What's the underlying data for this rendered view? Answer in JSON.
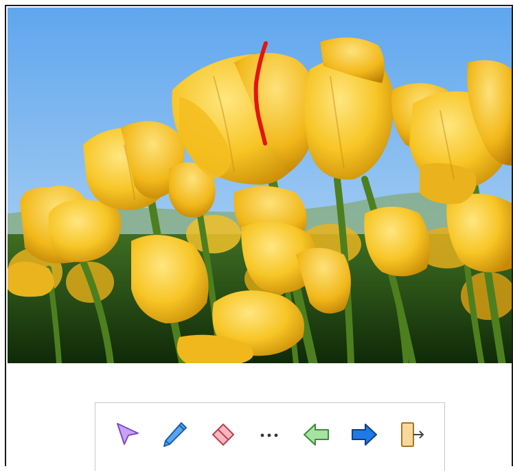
{
  "slide": {
    "image": "yellow-tulips-photo",
    "ink_annotation_color": "#e3150c"
  },
  "toolbar": {
    "tools": [
      {
        "name": "pointer",
        "icon": "arrow-pointer-icon",
        "color": "#b98cf0"
      },
      {
        "name": "pen",
        "icon": "pen-icon",
        "color": "#3b8fe0"
      },
      {
        "name": "eraser",
        "icon": "eraser-icon",
        "color": "#f4a3ad"
      },
      {
        "name": "more",
        "icon": "more-options-icon",
        "color": "#333333"
      },
      {
        "name": "previous",
        "icon": "arrow-left-icon",
        "color": "#8fd58a"
      },
      {
        "name": "next",
        "icon": "arrow-right-icon",
        "color": "#1a73e8"
      },
      {
        "name": "exit",
        "icon": "exit-slideshow-icon",
        "color": "#f7d79a"
      }
    ]
  }
}
